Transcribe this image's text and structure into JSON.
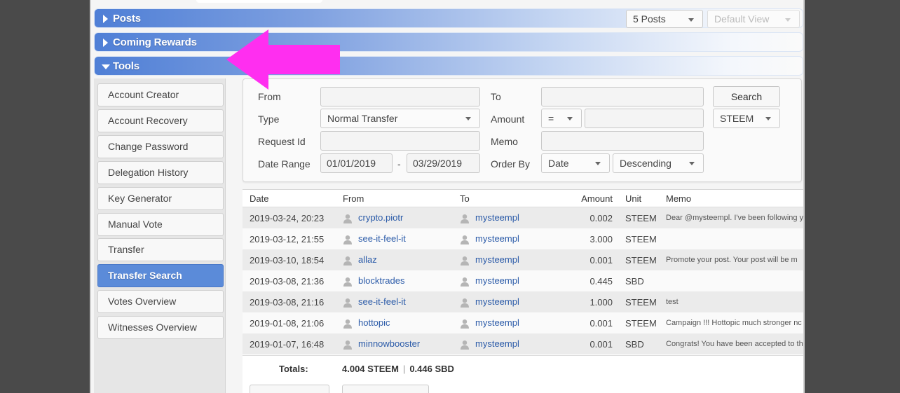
{
  "sections": {
    "posts": {
      "title": "Posts",
      "count_select": "5 Posts",
      "view_select": "Default View"
    },
    "coming_rewards": {
      "title": "Coming Rewards"
    },
    "tools": {
      "title": "Tools"
    }
  },
  "sidebar": {
    "items": [
      {
        "label": "Account Creator"
      },
      {
        "label": "Account Recovery"
      },
      {
        "label": "Change Password"
      },
      {
        "label": "Delegation History"
      },
      {
        "label": "Key Generator"
      },
      {
        "label": "Manual Vote"
      },
      {
        "label": "Transfer"
      },
      {
        "label": "Transfer Search",
        "active": true
      },
      {
        "label": "Votes Overview"
      },
      {
        "label": "Witnesses Overview"
      }
    ]
  },
  "form": {
    "from_label": "From",
    "from_value": "",
    "to_label": "To",
    "to_value": "",
    "search_button": "Search",
    "type_label": "Type",
    "type_value": "Normal Transfer",
    "amount_label": "Amount",
    "amount_op": "=",
    "amount_value": "",
    "currency": "STEEM",
    "request_id_label": "Request Id",
    "request_id_value": "",
    "memo_label": "Memo",
    "memo_value": "",
    "date_range_label": "Date Range",
    "date_from": "01/01/2019",
    "date_sep": "-",
    "date_to": "03/29/2019",
    "order_by_label": "Order By",
    "order_field": "Date",
    "order_dir": "Descending"
  },
  "table": {
    "headers": {
      "date": "Date",
      "from": "From",
      "to": "To",
      "amount": "Amount",
      "unit": "Unit",
      "memo": "Memo"
    },
    "rows": [
      {
        "date": "2019-03-24, 20:23",
        "from": "crypto.piotr",
        "to": "mysteempl",
        "amount": "0.002",
        "unit": "STEEM",
        "memo": "Dear @mysteempl. I've been following y"
      },
      {
        "date": "2019-03-12, 21:55",
        "from": "see-it-feel-it",
        "to": "mysteempl",
        "amount": "3.000",
        "unit": "STEEM",
        "memo": ""
      },
      {
        "date": "2019-03-10, 18:54",
        "from": "allaz",
        "to": "mysteempl",
        "amount": "0.001",
        "unit": "STEEM",
        "memo": "Promote your post. Your post will be m"
      },
      {
        "date": "2019-03-08, 21:36",
        "from": "blocktrades",
        "to": "mysteempl",
        "amount": "0.445",
        "unit": "SBD",
        "memo": ""
      },
      {
        "date": "2019-03-08, 21:16",
        "from": "see-it-feel-it",
        "to": "mysteempl",
        "amount": "1.000",
        "unit": "STEEM",
        "memo": "test"
      },
      {
        "date": "2019-01-08, 21:06",
        "from": "hottopic",
        "to": "mysteempl",
        "amount": "0.001",
        "unit": "STEEM",
        "memo": "Campaign !!! Hottopic much stronger nc"
      },
      {
        "date": "2019-01-07, 16:48",
        "from": "minnowbooster",
        "to": "mysteempl",
        "amount": "0.001",
        "unit": "SBD",
        "memo": "Congrats! You have been accepted to th"
      }
    ],
    "totals_label": "Totals:",
    "total_steem": "4.004 STEEM",
    "total_sep": "|",
    "total_sbd": "0.446 SBD"
  },
  "colors": {
    "accent": "#5b8bd9",
    "annotation_arrow": "#ff2ef0"
  },
  "icons": {
    "user": "user-icon",
    "annotation": "pink-arrow-icon"
  }
}
